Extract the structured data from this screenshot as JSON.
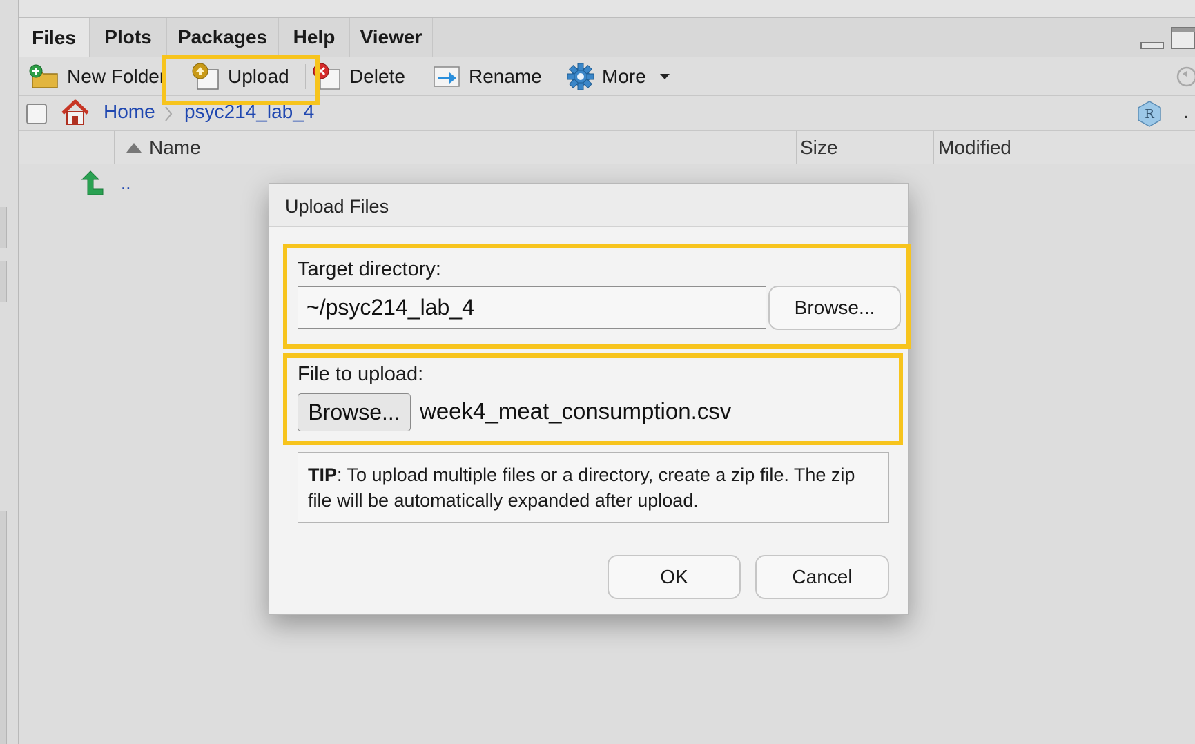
{
  "tabs": [
    {
      "label": "Files",
      "active": true
    },
    {
      "label": "Plots",
      "active": false
    },
    {
      "label": "Packages",
      "active": false
    },
    {
      "label": "Help",
      "active": false
    },
    {
      "label": "Viewer",
      "active": false
    }
  ],
  "toolbar": {
    "new_folder_label": "New Folder",
    "upload_label": "Upload",
    "delete_label": "Delete",
    "rename_label": "Rename",
    "more_label": "More"
  },
  "breadcrumb": {
    "home_label": "Home",
    "current_label": "psyc214_lab_4",
    "overflow_label": "."
  },
  "file_table": {
    "columns": [
      "Name",
      "Size",
      "Modified"
    ],
    "parent_entry": ".."
  },
  "dialog": {
    "title": "Upload Files",
    "target_label": "Target directory:",
    "target_value": "~/psyc214_lab_4",
    "target_browse_label": "Browse...",
    "file_label": "File to upload:",
    "file_browse_label": "Browse...",
    "file_name": "week4_meat_consumption.csv",
    "tip_bold": "TIP",
    "tip_text": ": To upload multiple files or a directory, create a zip file. The zip file will be automatically expanded after upload.",
    "ok_label": "OK",
    "cancel_label": "Cancel"
  },
  "colors": {
    "highlight": "#f7c41d",
    "link": "#1f47b0",
    "dialog_bg": "#f3f3f3",
    "pane_bg": "#dddddd"
  },
  "icons": [
    "new-folder-icon",
    "upload-icon",
    "delete-icon",
    "rename-icon",
    "gear-icon",
    "chevron-down-icon",
    "home-icon",
    "r-project-icon",
    "parent-dir-arrow-icon",
    "sort-asc-icon",
    "minimize-icon",
    "maximize-icon",
    "refresh-icon"
  ]
}
